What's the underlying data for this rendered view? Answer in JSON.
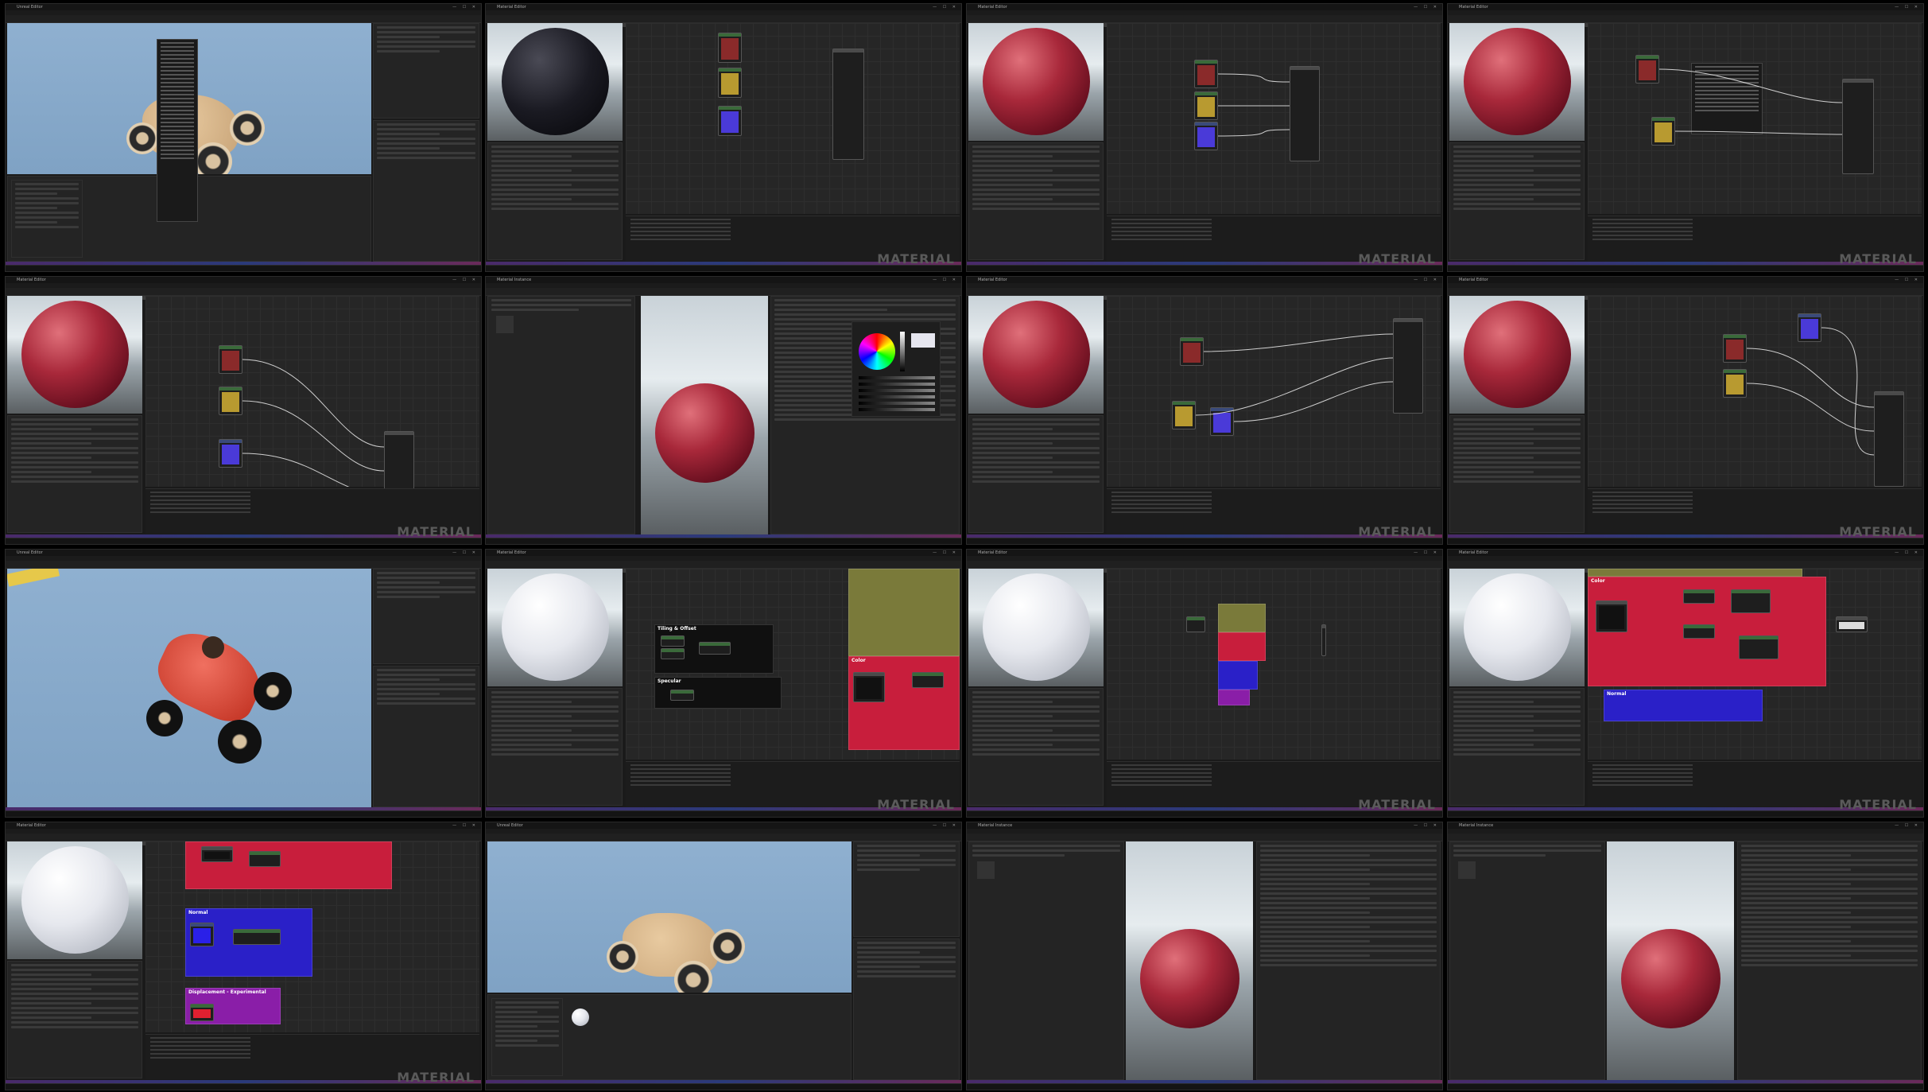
{
  "grid": {
    "columns": 4,
    "rows": 4,
    "watermark_text": "MATERIAL",
    "tiles": [
      {
        "id": 1,
        "scene": "level-editor",
        "watermark": false,
        "title": "Unreal Editor"
      },
      {
        "id": 2,
        "scene": "material-editor-black-sphere",
        "watermark": true,
        "title": "Material Editor"
      },
      {
        "id": 3,
        "scene": "material-editor-red-sphere",
        "watermark": true,
        "title": "Material Editor"
      },
      {
        "id": 4,
        "scene": "material-editor-red-sphere-context-menu",
        "watermark": true,
        "title": "Material Editor"
      },
      {
        "id": 5,
        "scene": "material-editor-red-sphere",
        "watermark": true,
        "title": "Material Editor"
      },
      {
        "id": 6,
        "scene": "material-instance-color-picker",
        "watermark": false,
        "title": "Material Instance"
      },
      {
        "id": 7,
        "scene": "material-editor-red-sphere",
        "watermark": true,
        "title": "Material Editor"
      },
      {
        "id": 8,
        "scene": "material-editor-red-sphere",
        "watermark": true,
        "title": "Material Editor"
      },
      {
        "id": 9,
        "scene": "level-editor-red-car",
        "watermark": false,
        "title": "Unreal Editor"
      },
      {
        "id": 10,
        "scene": "material-editor-white-tiling",
        "watermark": true,
        "title": "Material Editor"
      },
      {
        "id": 11,
        "scene": "material-editor-white-overview",
        "watermark": true,
        "title": "Material Editor"
      },
      {
        "id": 12,
        "scene": "material-editor-white-color-group",
        "watermark": true,
        "title": "Material Editor"
      },
      {
        "id": 13,
        "scene": "material-editor-white-groups",
        "watermark": true,
        "title": "Material Editor"
      },
      {
        "id": 14,
        "scene": "level-editor-wood-car",
        "watermark": false,
        "title": "Unreal Editor"
      },
      {
        "id": 15,
        "scene": "material-instance-red-sphere",
        "watermark": false,
        "title": "Material Instance"
      },
      {
        "id": 16,
        "scene": "material-instance-red-sphere",
        "watermark": false,
        "title": "Material Instance"
      }
    ]
  },
  "comment_groups": {
    "tiling": "Tiling & Offset",
    "specular": "Specular",
    "color": "Color",
    "normal": "Normal",
    "displacement": "Displacement - Experimental"
  },
  "colors": {
    "editor_bg": "#1a1a1a",
    "graph_bg": "#262626",
    "color_group": "#c81e3c",
    "normal_group": "#2a20c8",
    "displacement_group": "#8a1ea8",
    "olive_group": "#7a7a3a",
    "accent_blue": "#2a6fd6"
  }
}
